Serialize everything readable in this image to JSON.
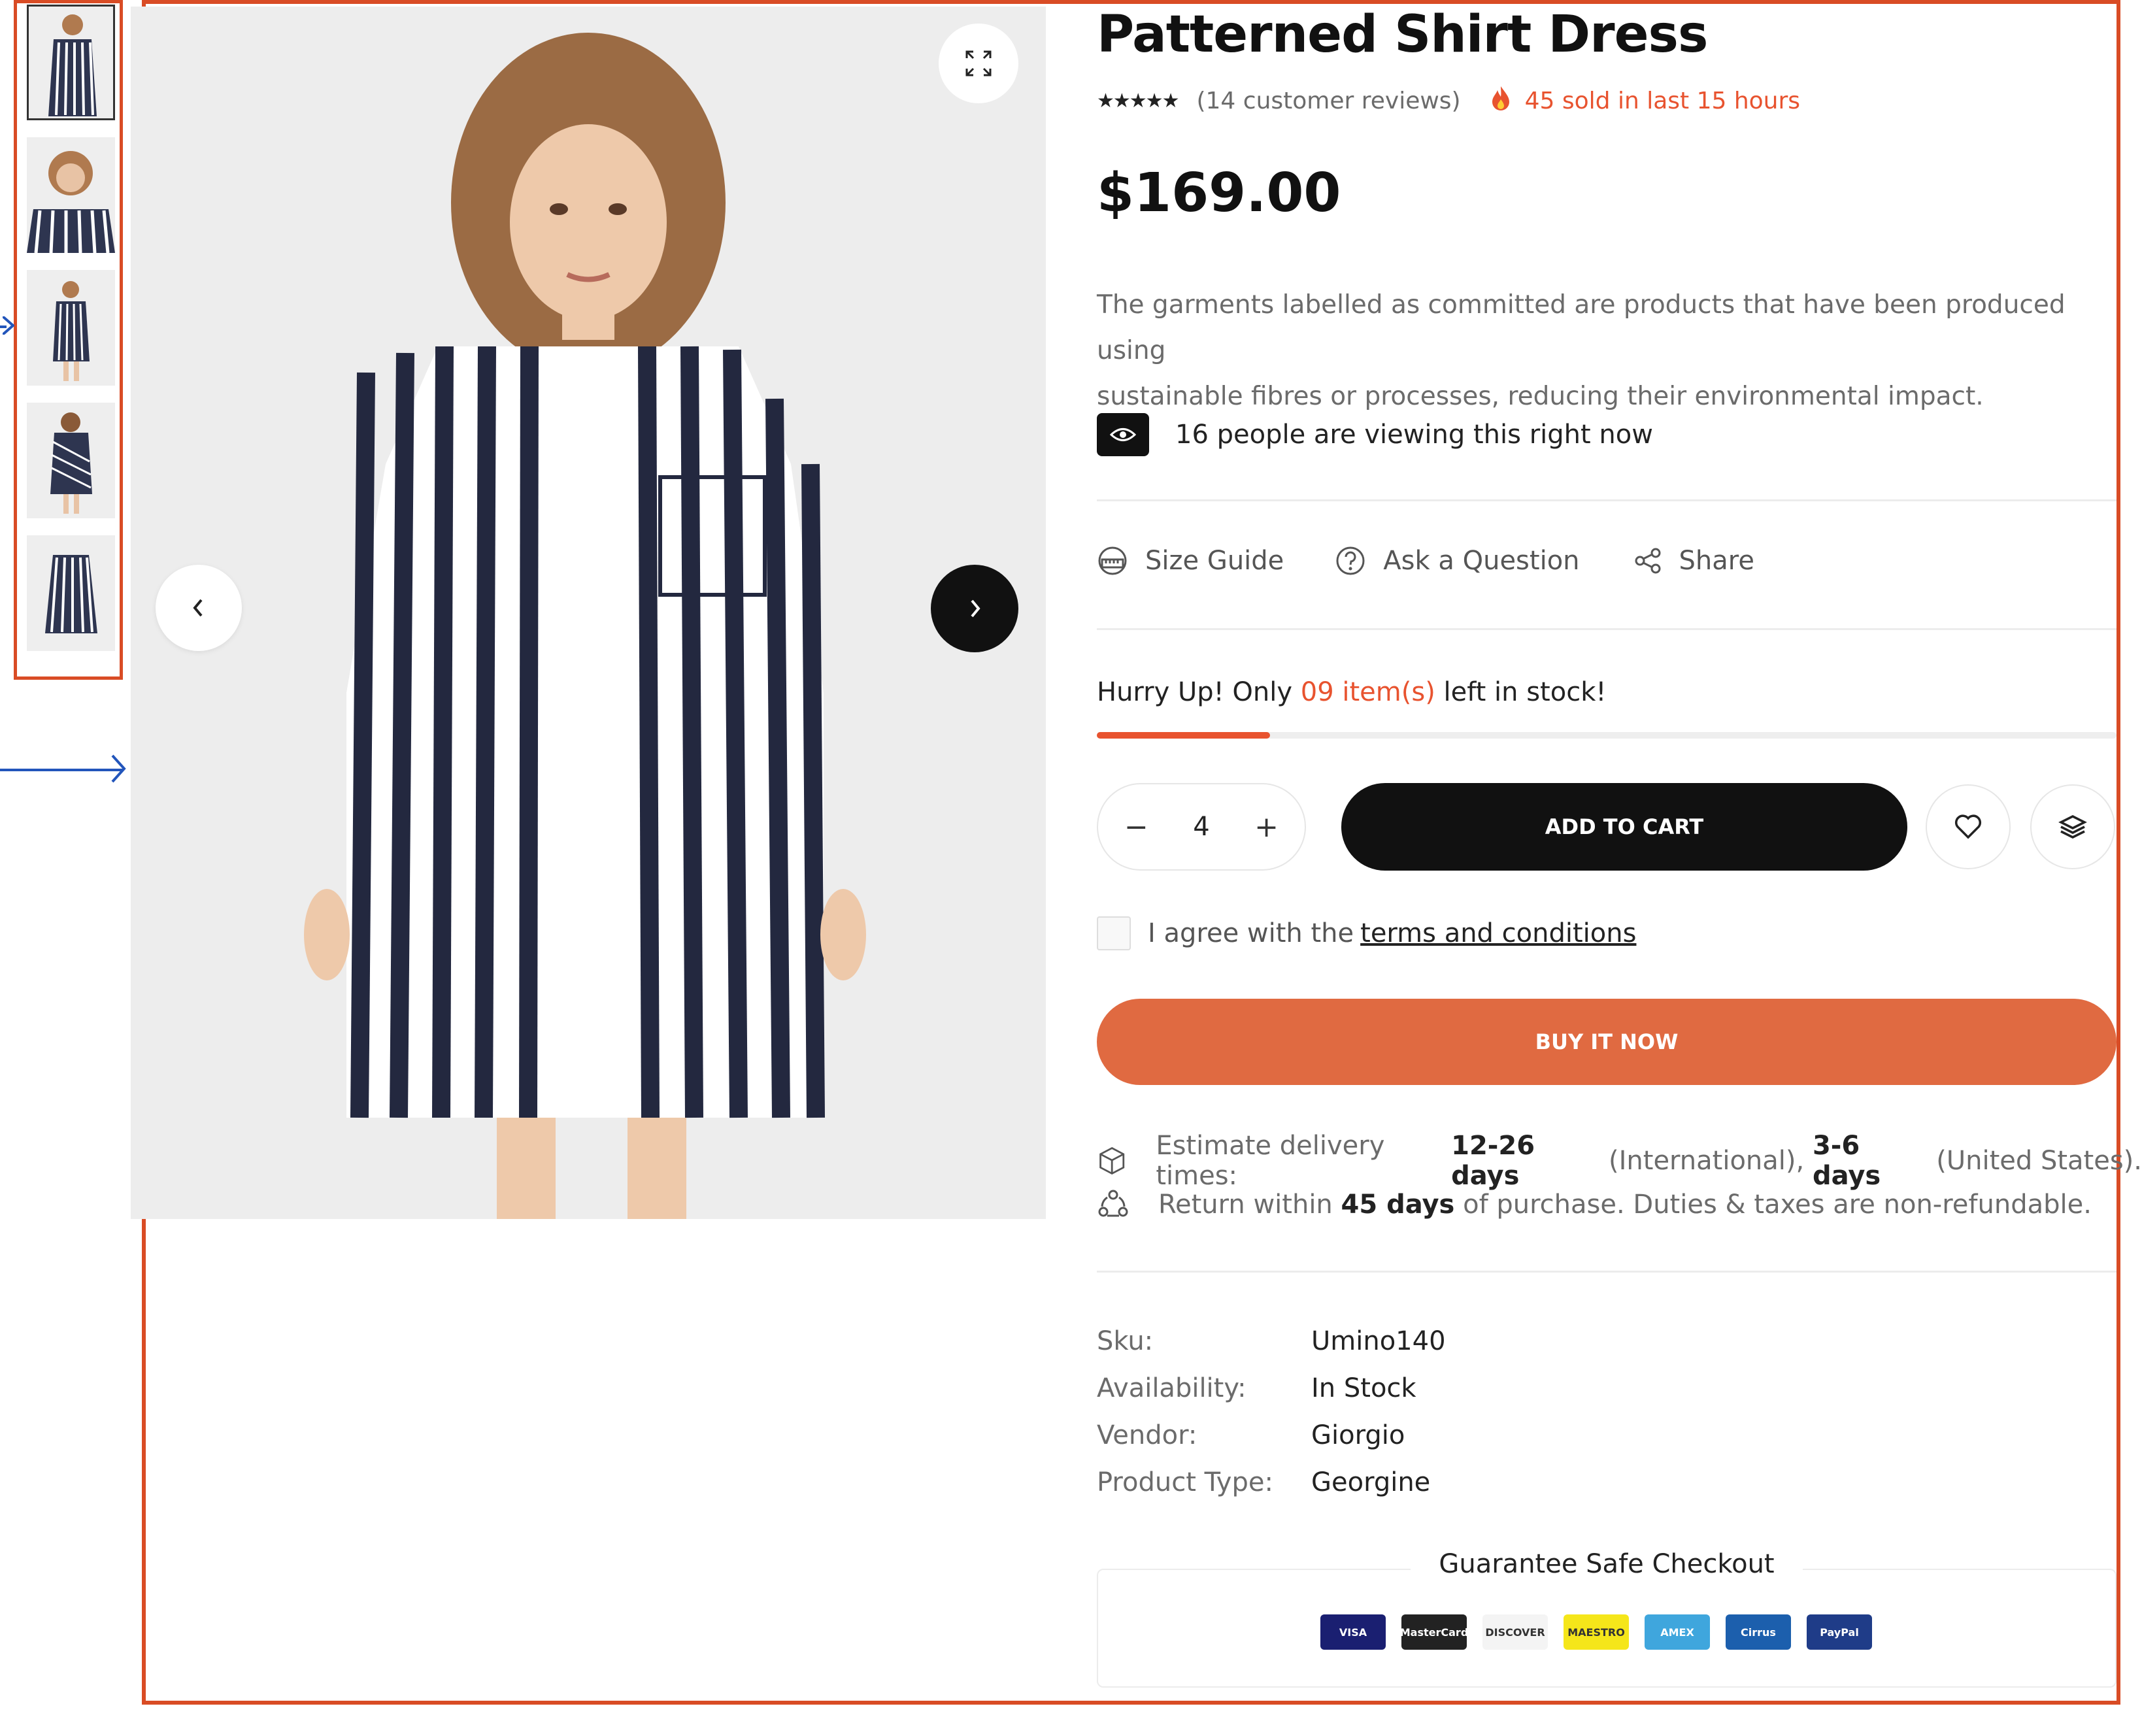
{
  "product": {
    "title": "Patterned Shirt Dress",
    "reviews": "(14 customer reviews)",
    "sold": "45 sold in last 15 hours",
    "price": "$169.00",
    "description_line1": "The garments labelled as committed are products that have been produced using",
    "description_line2": "sustainable fibres or processes, reducing their environmental impact.",
    "viewers": "16 people are viewing this right now",
    "rating": 5
  },
  "actions": {
    "size_guide": "Size Guide",
    "ask_question": "Ask a Question",
    "share": "Share"
  },
  "stock": {
    "prefix": "Hurry Up! Only ",
    "count": "09 item(s)",
    "suffix": " left in stock!",
    "progress_fraction": 0.17
  },
  "cart": {
    "quantity": "4",
    "minus": "−",
    "plus": "+",
    "add_to_cart": "ADD TO CART",
    "agree_prefix": "I agree with the ",
    "terms_link": "terms and conditions",
    "buy_now": "BUY IT NOW"
  },
  "delivery": {
    "estimate_prefix": "Estimate delivery times: ",
    "intl_days": "12-26 days",
    "intl_label": " (International), ",
    "us_days": "3-6 days",
    "us_label": " (United States).",
    "return_prefix": "Return within ",
    "return_days": "45 days",
    "return_suffix": " of purchase. Duties & taxes are non-refundable."
  },
  "meta": [
    {
      "label": "Sku:",
      "value": "Umino140"
    },
    {
      "label": "Availability:",
      "value": "In Stock"
    },
    {
      "label": "Vendor:",
      "value": "Giorgio"
    },
    {
      "label": "Product Type:",
      "value": "Georgine"
    }
  ],
  "checkout": {
    "title": "Guarantee Safe Checkout",
    "payments": [
      {
        "name": "VISA",
        "bg": "#1a1f71",
        "fg": "#ffffff"
      },
      {
        "name": "MasterCard",
        "bg": "#222222",
        "fg": "#ffffff"
      },
      {
        "name": "DISCOVER",
        "bg": "#f4f4f4",
        "fg": "#333333"
      },
      {
        "name": "MAESTRO",
        "bg": "#f5e61a",
        "fg": "#333333"
      },
      {
        "name": "AMEX",
        "bg": "#3fa6dd",
        "fg": "#ffffff"
      },
      {
        "name": "Cirrus",
        "bg": "#1c5fad",
        "fg": "#ffffff"
      },
      {
        "name": "PayPal",
        "bg": "#1f3c88",
        "fg": "#ffffff"
      }
    ]
  },
  "colors": {
    "accent": "#e8532f",
    "buy_button": "#e06a41",
    "frame": "#d94c25",
    "arrow": "#2255bb"
  }
}
